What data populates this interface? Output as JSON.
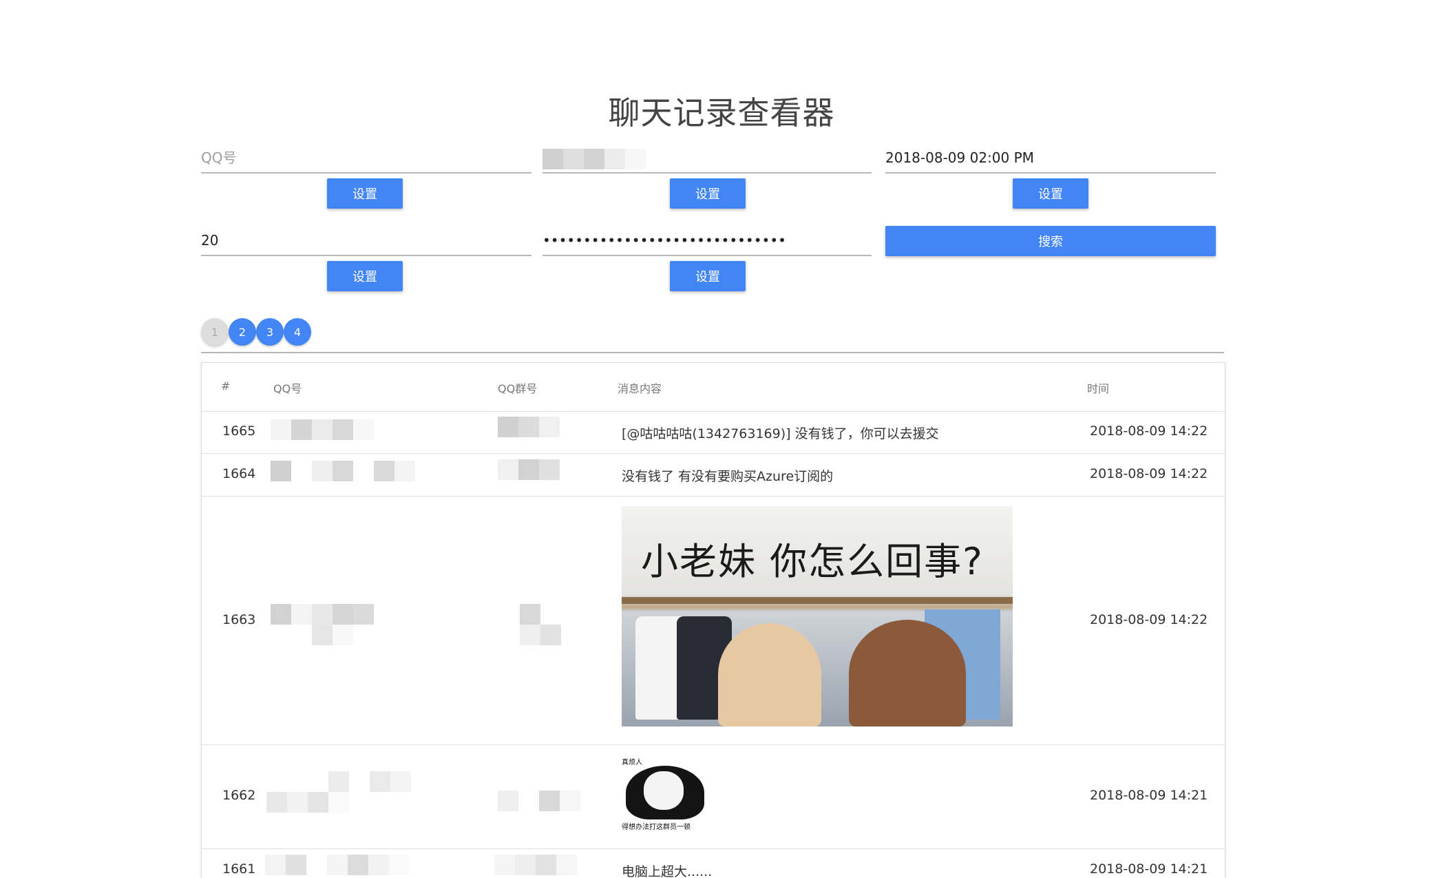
{
  "app": {
    "title": "聊天记录查看器"
  },
  "form": {
    "qq_field": {
      "value": "",
      "placeholder": "QQ号"
    },
    "group_field": {
      "value": "",
      "placeholder": ""
    },
    "datetime_field": {
      "value": "2018-08-09 02:00 PM",
      "placeholder": ""
    },
    "limit_field": {
      "value": "20",
      "placeholder": ""
    },
    "password_field": {
      "value": "sourcepasswordmaskedvalue12345",
      "placeholder": ""
    },
    "set_label": "设置",
    "search_label": "搜索"
  },
  "pagination": {
    "pages": [
      "1",
      "2",
      "3",
      "4"
    ],
    "current": "1"
  },
  "table": {
    "headers": {
      "id": "#",
      "qq": "QQ号",
      "group": "QQ群号",
      "content": "消息内容",
      "time": "时间"
    },
    "rows": [
      {
        "id": "1665",
        "content": "[@咕咕咕咕(1342763169)] 没有钱了，你可以去援交",
        "time": "2018-08-09 14:22"
      },
      {
        "id": "1664",
        "content": "没有钱了 有没有要购买Azure订阅的",
        "time": "2018-08-09 14:22"
      },
      {
        "id": "1663",
        "content": "",
        "time": "2018-08-09 14:22",
        "image_text": "小老妹  你怎么回事?"
      },
      {
        "id": "1662",
        "content": "",
        "time": "2018-08-09 14:21",
        "image_caption_top": "真烦人",
        "image_caption_bottom": "得想办法打这群员一顿"
      },
      {
        "id": "1661",
        "content": "电脑上超大......",
        "time": "2018-08-09 14:21"
      }
    ]
  },
  "colors": {
    "primary": "#4285f4",
    "inactive_page": "#dddddd"
  }
}
